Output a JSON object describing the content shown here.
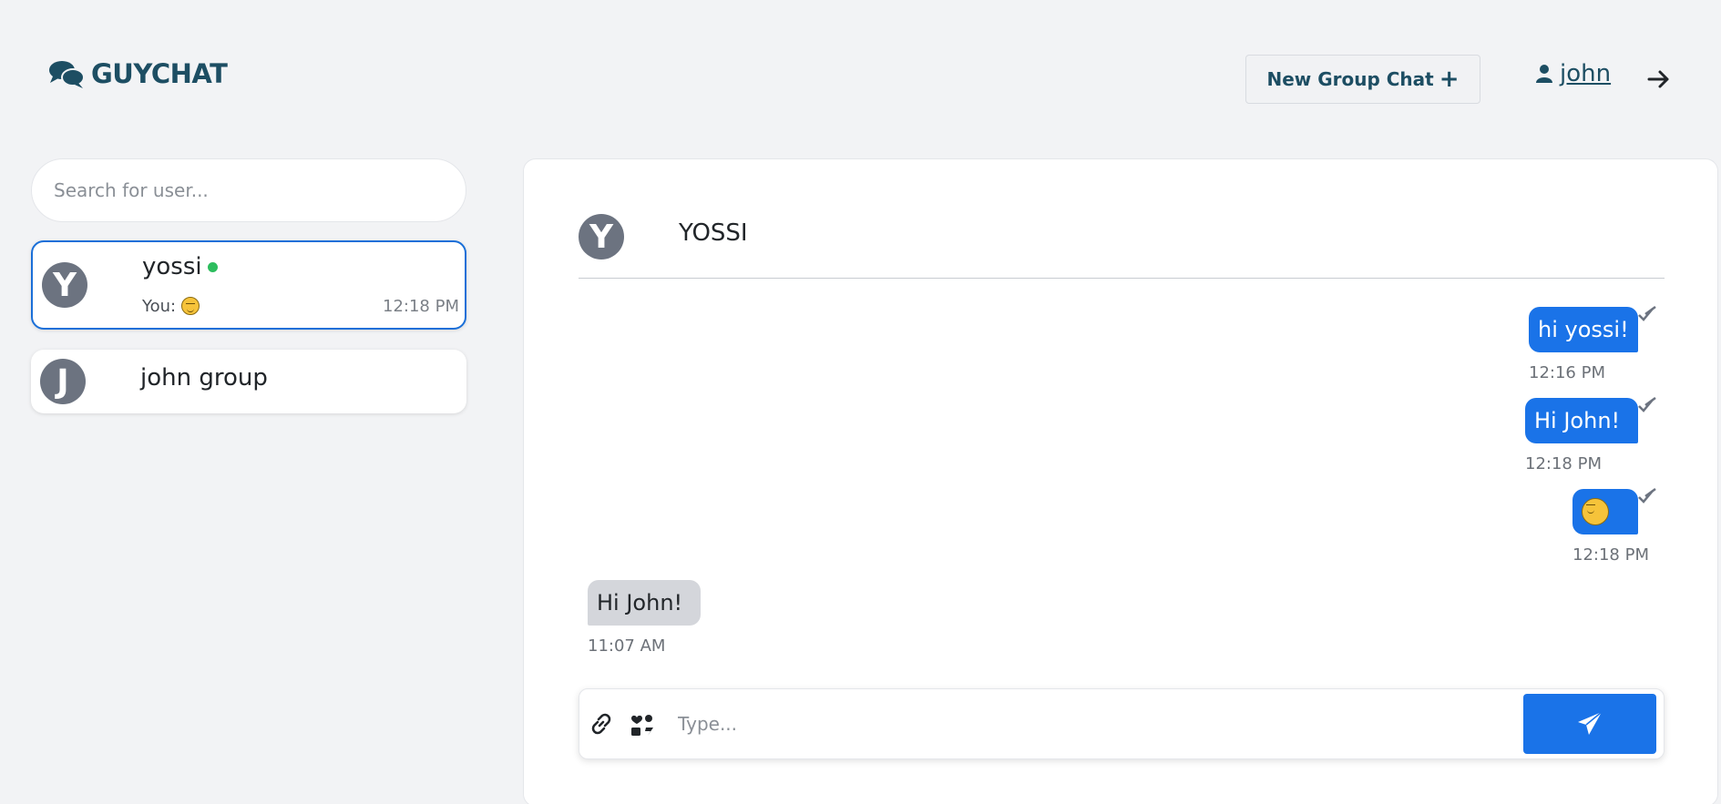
{
  "app": {
    "logo_text": "GUYCHAT",
    "accent_color": "#1a73e8",
    "brand_color": "#1d4e63"
  },
  "header": {
    "new_group_label": "New Group Chat",
    "new_group_icon": "plus-icon",
    "username": "john",
    "user_icon": "user-icon",
    "logout_icon": "arrow-right-icon"
  },
  "sidebar": {
    "search_placeholder": "Search for user...",
    "chats": [
      {
        "initial": "Y",
        "name": "yossi",
        "online": true,
        "preview_prefix": "You:",
        "preview_emoji": "smiling-face-emoji",
        "time": "12:18 PM",
        "active": true
      },
      {
        "initial": "J",
        "name": "john group",
        "active": false
      }
    ]
  },
  "chat": {
    "header_initial": "Y",
    "header_name": "YOSSI",
    "messages": [
      {
        "direction": "out",
        "text": "hi yossi!",
        "time": "12:16 PM",
        "read": true
      },
      {
        "direction": "out",
        "text": "Hi John!",
        "time": "12:18 PM",
        "read": true
      },
      {
        "direction": "out",
        "emoji": "smiling-face-emoji",
        "time": "12:18 PM",
        "read": true
      },
      {
        "direction": "in",
        "text": "Hi John!",
        "time": "11:07 AM"
      }
    ],
    "composer": {
      "placeholder": "Type...",
      "attach_icon": "link-icon",
      "sticker_icon": "sticker-icon",
      "send_icon": "paper-plane-icon"
    }
  }
}
